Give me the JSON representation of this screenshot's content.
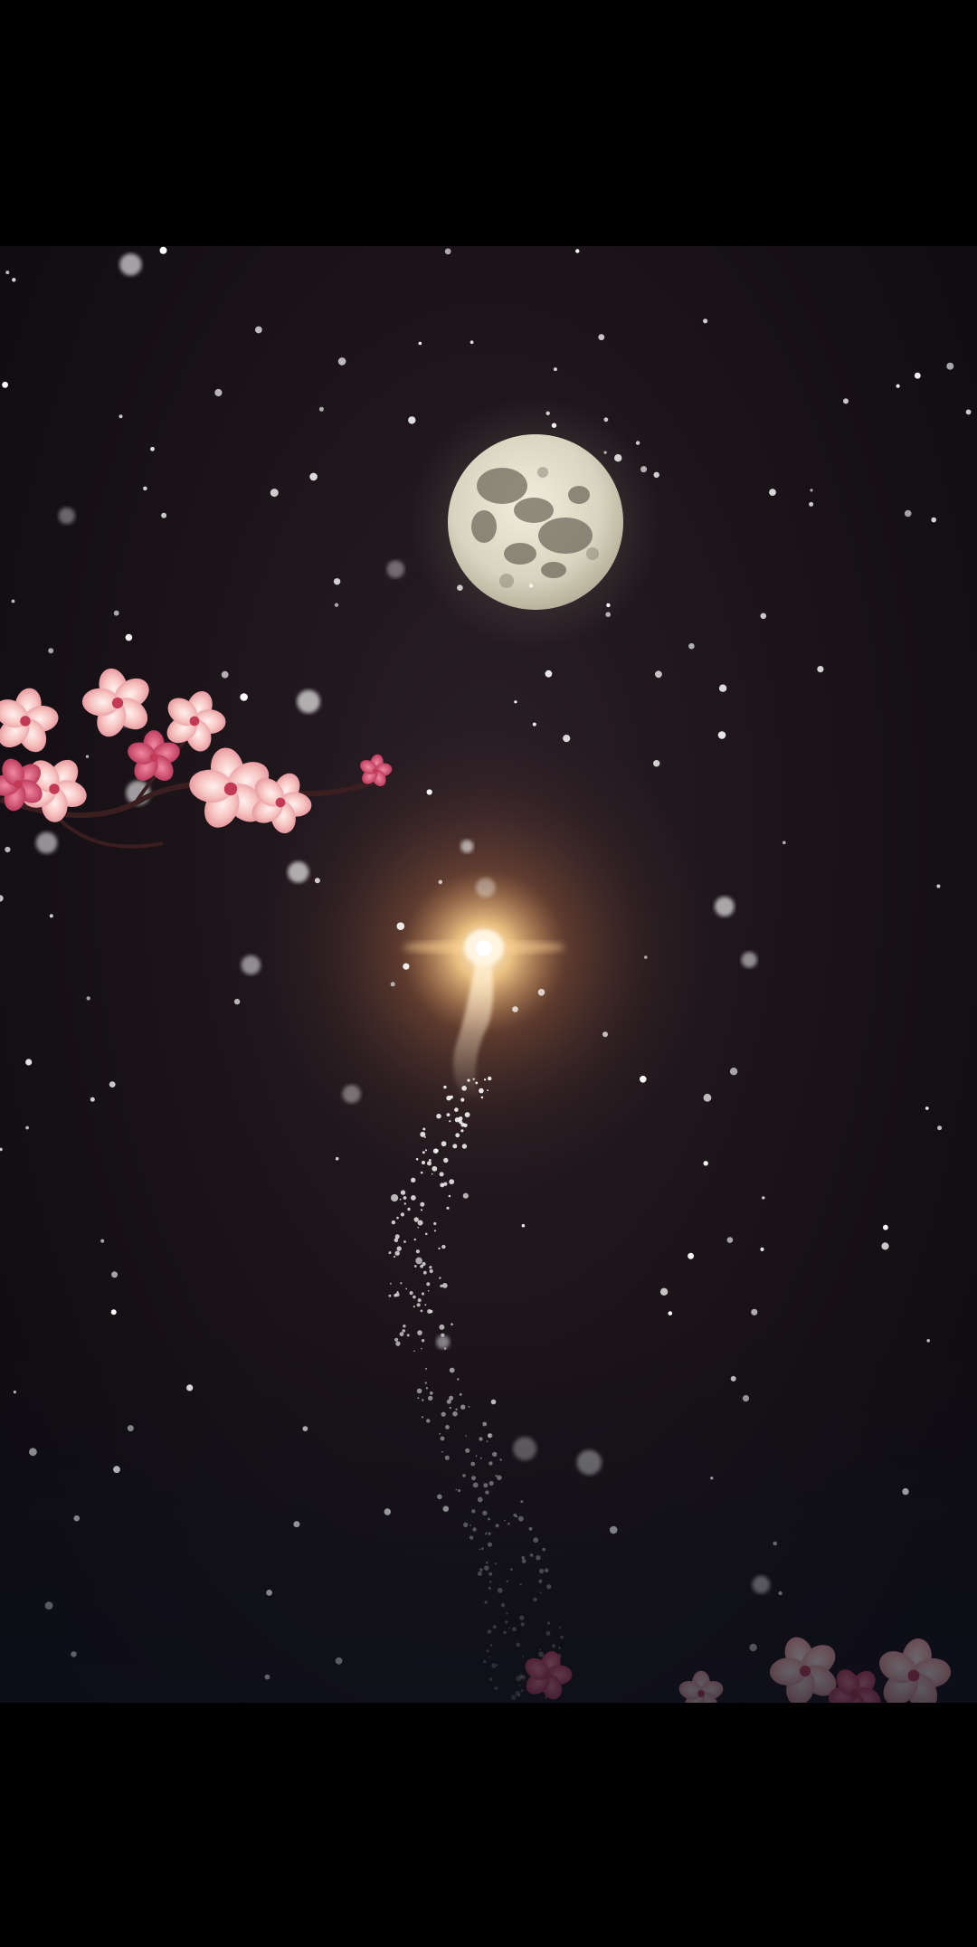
{
  "colors": {
    "background": "#000000",
    "sky": "#1b1419",
    "moon": "#dcd9c6",
    "glow": "#ffcf8a",
    "blossom": "#f4b6b4",
    "blossom_deep": "#c83d5c"
  },
  "scene": {
    "elements": [
      "full-moon",
      "glowing-light",
      "sparkle-trail",
      "falling-snow",
      "cherry-blossom-branch",
      "cherry-blossoms"
    ]
  }
}
